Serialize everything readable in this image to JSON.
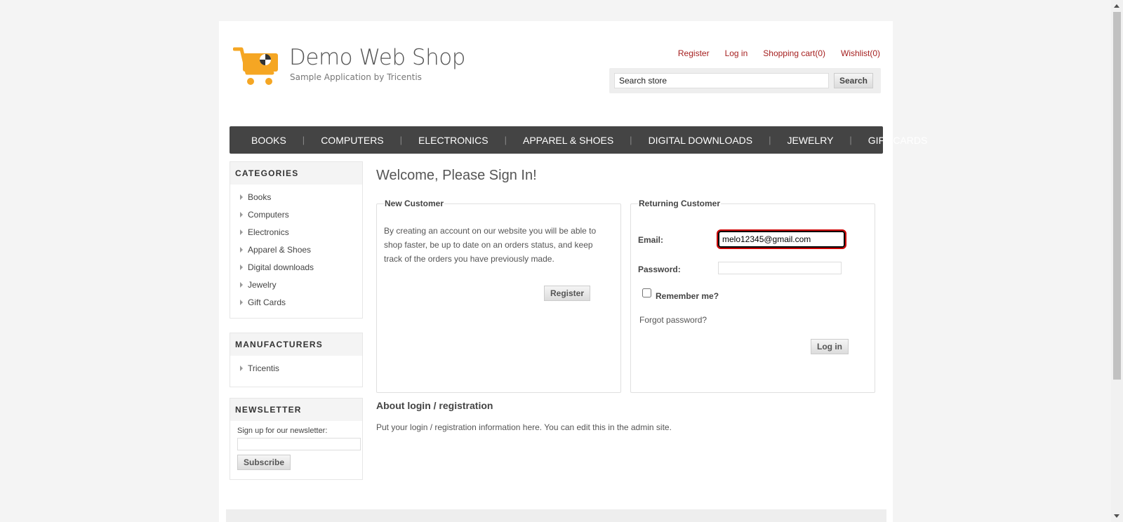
{
  "header": {
    "store_name": "Demo Web Shop",
    "tagline": "Sample Application by Tricentis",
    "logo_icon": "shopping-cart-icon",
    "links": [
      "Register",
      "Log in",
      "Shopping cart(0)",
      "Wishlist(0)"
    ],
    "search_value": "Search store",
    "search_button": "Search"
  },
  "menu": [
    "BOOKS",
    "COMPUTERS",
    "ELECTRONICS",
    "APPAREL & SHOES",
    "DIGITAL DOWNLOADS",
    "JEWELRY",
    "GIFT CARDS"
  ],
  "sidebar": {
    "categories_title": "Categories",
    "categories": [
      "Books",
      "Computers",
      "Electronics",
      "Apparel & Shoes",
      "Digital downloads",
      "Jewelry",
      "Gift Cards"
    ],
    "manufacturers_title": "Manufacturers",
    "manufacturers": [
      "Tricentis"
    ],
    "newsletter_title": "Newsletter",
    "newsletter_label": "Sign up for our newsletter:",
    "subscribe_button": "Subscribe"
  },
  "main": {
    "title": "Welcome, Please Sign In!",
    "new_customer": {
      "legend": "New Customer",
      "text": "By creating an account on our website you will be able to shop faster, be up to date on an orders status, and keep track of the orders you have previously made.",
      "register_button": "Register"
    },
    "returning_customer": {
      "legend": "Returning Customer",
      "email_label": "Email:",
      "email_value": "melo12345@gmail.com",
      "password_label": "Password:",
      "remember_label": "Remember me?",
      "forgot_link": "Forgot password?",
      "login_button": "Log in"
    },
    "about_title": "About login / registration",
    "about_text": "Put your login / registration information here. You can edit this in the admin site."
  },
  "colors": {
    "link": "#a51f1f",
    "menu_bg": "#444444",
    "logo_orange": "#f5a623",
    "email_focus": "#cc0000"
  }
}
